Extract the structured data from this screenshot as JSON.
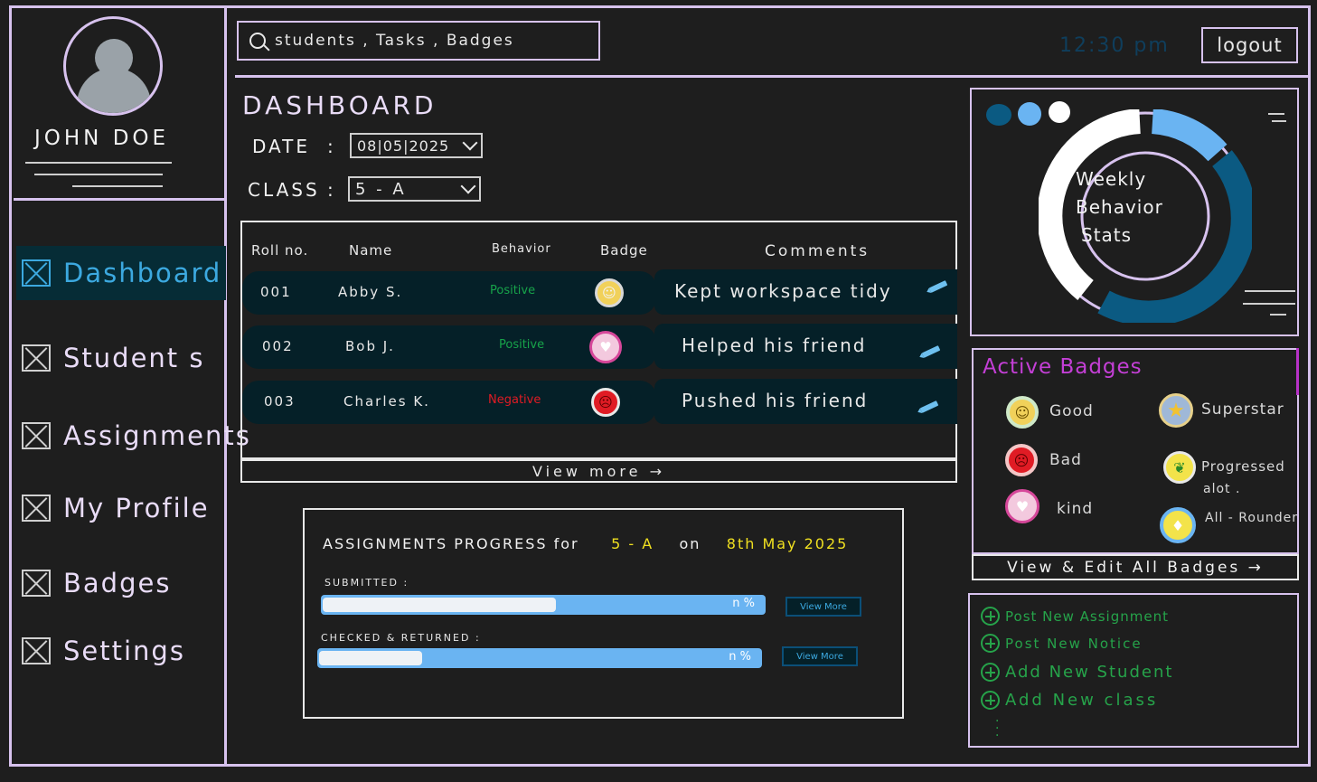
{
  "profile": {
    "name": "JOHN DOE"
  },
  "sidebar": {
    "items": [
      {
        "label": "Dashboard",
        "icon": "checkbox-x-icon",
        "active": true
      },
      {
        "label": "Student s",
        "icon": "checkbox-x-icon"
      },
      {
        "label": "Assignments",
        "icon": "checkbox-x-icon"
      },
      {
        "label": "My Profile",
        "icon": "checkbox-x-icon"
      },
      {
        "label": "Badges",
        "icon": "checkbox-x-icon"
      },
      {
        "label": "Settings",
        "icon": "checkbox-x-icon"
      }
    ]
  },
  "topbar": {
    "search_placeholder": "students , Tasks , Badges",
    "time": "12:30 pm",
    "logout_label": "logout"
  },
  "dashboard": {
    "title": "DASHBOARD",
    "date_label": "DATE",
    "date_value": "08|05|2025",
    "class_label": "CLASS",
    "class_value": "5 - A",
    "colon": ":"
  },
  "table": {
    "headers": [
      "Roll no.",
      "Name",
      "Behavior",
      "Badge",
      "Comments"
    ],
    "rows": [
      {
        "roll": "001",
        "name": "Abby S.",
        "behavior": "Positive",
        "badge": "good-badge-icon",
        "comment": "Kept workspace tidy"
      },
      {
        "roll": "002",
        "name": "Bob J.",
        "behavior": "Positive",
        "badge": "kind-badge-icon",
        "comment": "Helped his friend"
      },
      {
        "roll": "003",
        "name": "Charles K.",
        "behavior": "Negative",
        "badge": "bad-badge-icon",
        "comment": "Pushed his friend"
      }
    ],
    "view_more_label": "View more →"
  },
  "assignments": {
    "title_prefix": "ASSIGNMENTS PROGRESS for",
    "class": "5 - A",
    "on": "on",
    "date": "8th May 2025",
    "submitted_label": "SUBMITTED :",
    "submitted_pct": "n %",
    "returned_label": "CHECKED & RETURNED :",
    "returned_pct": "n %",
    "view_more_small": "View More"
  },
  "weekly_stats": {
    "line1": "Weekly",
    "line2": "Behavior",
    "line3": "Stats"
  },
  "badges": {
    "title": "Active Badges",
    "items": [
      {
        "label": "Good",
        "icon": "good-badge-icon"
      },
      {
        "label": "Superstar",
        "icon": "superstar-badge-icon"
      },
      {
        "label": "Bad",
        "icon": "bad-badge-icon"
      },
      {
        "label": "Progressed",
        "label2": "alot .",
        "icon": "progressed-badge-icon"
      },
      {
        "label": "kind",
        "icon": "kind-badge-icon"
      },
      {
        "label": "All - Rounder",
        "icon": "all-rounder-badge-icon"
      }
    ],
    "view_edit_label": "View & Edit All Badges →"
  },
  "actions": [
    "Post New Assignment",
    "Post New Notice",
    "Add New Student",
    "Add New class"
  ],
  "colors": {
    "accent": "#3ca9e0",
    "frame": "#d7c2ee",
    "positive": "#17a34a",
    "negative": "#e01b24",
    "highlight": "#f0e020",
    "badges_title": "#c43fd6"
  }
}
